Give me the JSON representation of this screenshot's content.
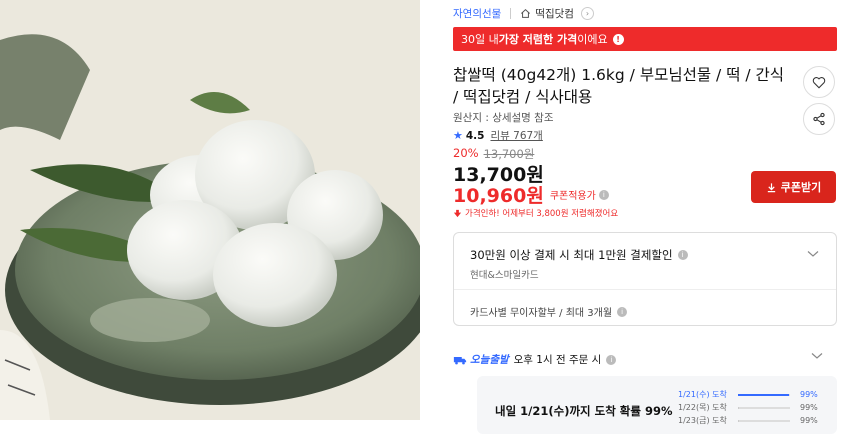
{
  "breadcrumb": {
    "brand": "자연의선물",
    "store": "떡집닷컴"
  },
  "promo": {
    "pre": "30일 내 ",
    "bold": "가장 저렴한 가격",
    "post": "이에요",
    "info_icon": "info-icon"
  },
  "product": {
    "title": "찹쌀떡 (40g42개) 1.6kg / 부모님선물 / 떡 / 간식 / 떡집닷컴 / 식사대용",
    "origin": "원산지 : 상세설명 참조",
    "rating": "4.5",
    "review_text": "리뷰 767개"
  },
  "price": {
    "discount_rate": "20%",
    "original": "13,700원",
    "sale": "13,700원",
    "coupon_price": "10,960원",
    "coupon_label": "쿠폰적용가",
    "drop_note": "가격인하! 어제부터 3,800원 저렴해졌어요"
  },
  "coupon_button": {
    "label": "쿠폰받기",
    "icon": "download-icon"
  },
  "card_offer": {
    "title": "30만원 이상 결제 시 최대 1만원 결제할인",
    "sub": "현대&스마일카드",
    "installment": "카드사별 무이자할부 / 최대 3개월"
  },
  "delivery": {
    "badge": "오늘출발",
    "text": "오후 1시 전 주문 시",
    "probability_text": "내일 1/21(수)까지 도착 확률 99%",
    "schedule": [
      {
        "date": "1/21(수) 도착",
        "pct": "99%",
        "fill": 0.99
      },
      {
        "date": "1/22(목) 도착",
        "pct": "99%",
        "fill": 0.01
      },
      {
        "date": "1/23(금) 도착",
        "pct": "99%",
        "fill": 0.01
      }
    ]
  },
  "colors": {
    "accent_red": "#ee2b2b",
    "button_red": "#d9251c",
    "link_blue": "#346aff"
  }
}
